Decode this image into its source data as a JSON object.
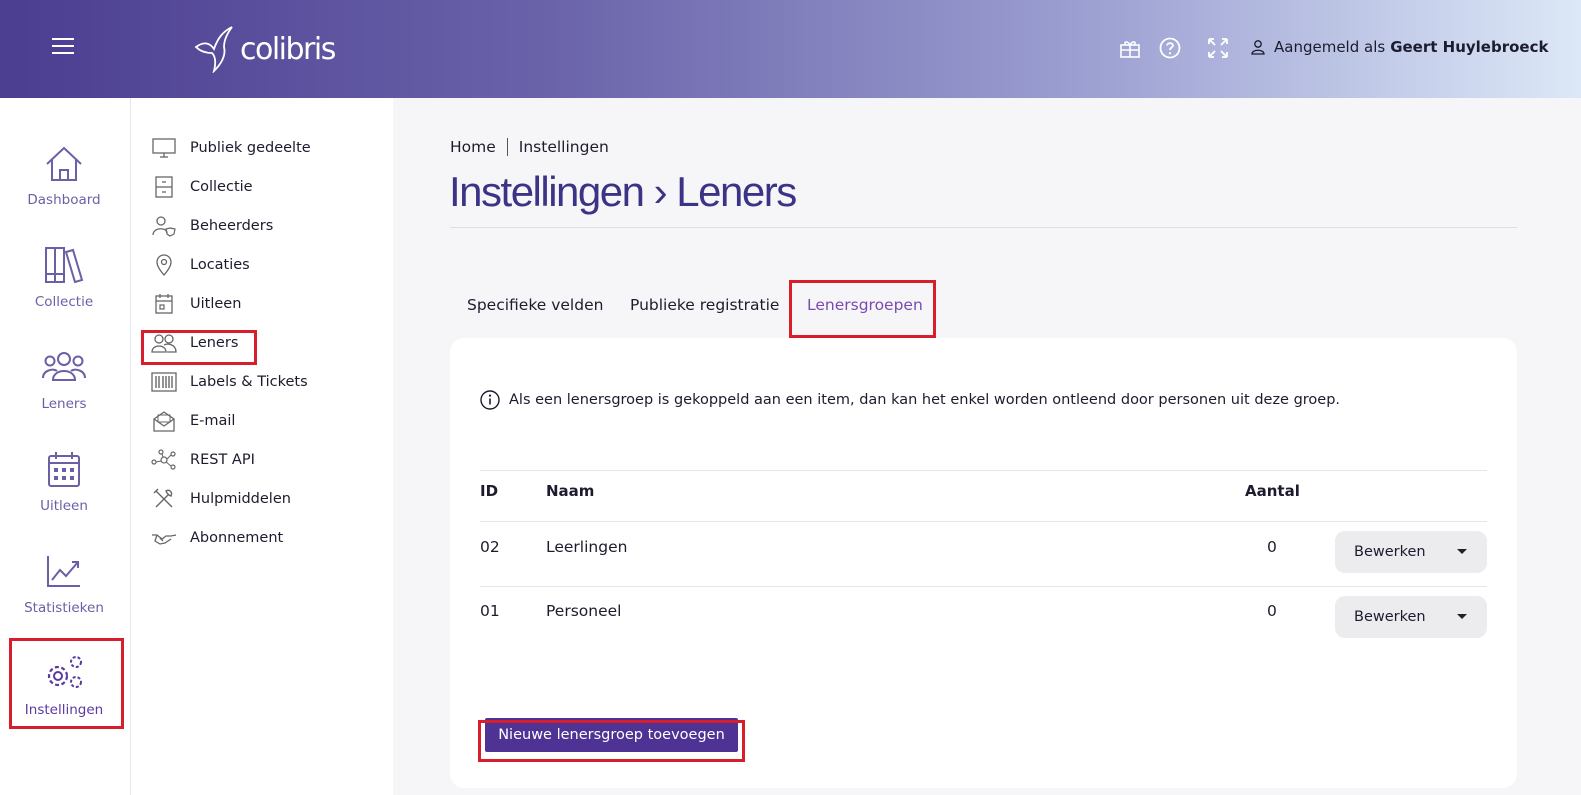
{
  "header": {
    "logo_text": "colibris",
    "user_prefix": "Aangemeld als",
    "user_name": "Geert Huylebroeck",
    "icons": [
      "menu-icon",
      "gift-icon",
      "help-icon",
      "fullscreen-icon",
      "user-icon"
    ]
  },
  "leftnav": {
    "items": [
      {
        "label": "Dashboard",
        "icon": "home-icon"
      },
      {
        "label": "Collectie",
        "icon": "books-icon"
      },
      {
        "label": "Leners",
        "icon": "people-icon"
      },
      {
        "label": "Uitleen",
        "icon": "calendar-icon"
      },
      {
        "label": "Statistieken",
        "icon": "chart-icon"
      },
      {
        "label": "Instellingen",
        "icon": "gears-icon",
        "active": true
      }
    ]
  },
  "submenu": {
    "items": [
      {
        "label": "Publiek gedeelte",
        "icon": "monitor-icon"
      },
      {
        "label": "Collectie",
        "icon": "cabinet-icon"
      },
      {
        "label": "Beheerders",
        "icon": "admin-icon"
      },
      {
        "label": "Locaties",
        "icon": "pin-icon"
      },
      {
        "label": "Uitleen",
        "icon": "calendar-icon"
      },
      {
        "label": "Leners",
        "icon": "people-icon",
        "active": true
      },
      {
        "label": "Labels & Tickets",
        "icon": "barcode-icon"
      },
      {
        "label": "E-mail",
        "icon": "mail-icon"
      },
      {
        "label": "REST API",
        "icon": "network-icon"
      },
      {
        "label": "Hulpmiddelen",
        "icon": "tools-icon"
      },
      {
        "label": "Abonnement",
        "icon": "handshake-icon"
      }
    ]
  },
  "breadcrumb": {
    "home": "Home",
    "current": "Instellingen"
  },
  "page": {
    "title": "Instellingen › Leners"
  },
  "tabs": [
    {
      "label": "Specifieke velden"
    },
    {
      "label": "Publieke registratie"
    },
    {
      "label": "Lenersgroepen",
      "active": true
    }
  ],
  "info_text": "Als een lenersgroep is gekoppeld aan een item, dan kan het enkel worden ontleend door personen uit deze groep.",
  "table": {
    "headers": {
      "id": "ID",
      "name": "Naam",
      "count": "Aantal"
    },
    "rows": [
      {
        "id": "02",
        "name": "Leerlingen",
        "count": "0",
        "action": "Bewerken"
      },
      {
        "id": "01",
        "name": "Personeel",
        "count": "0",
        "action": "Bewerken"
      }
    ]
  },
  "add_button": "Nieuwe lenersgroep toevoegen",
  "colors": {
    "brand": "#4e3394",
    "title": "#3b3486",
    "highlight": "#d81e2c",
    "active_tab": "#7a4ab0"
  }
}
